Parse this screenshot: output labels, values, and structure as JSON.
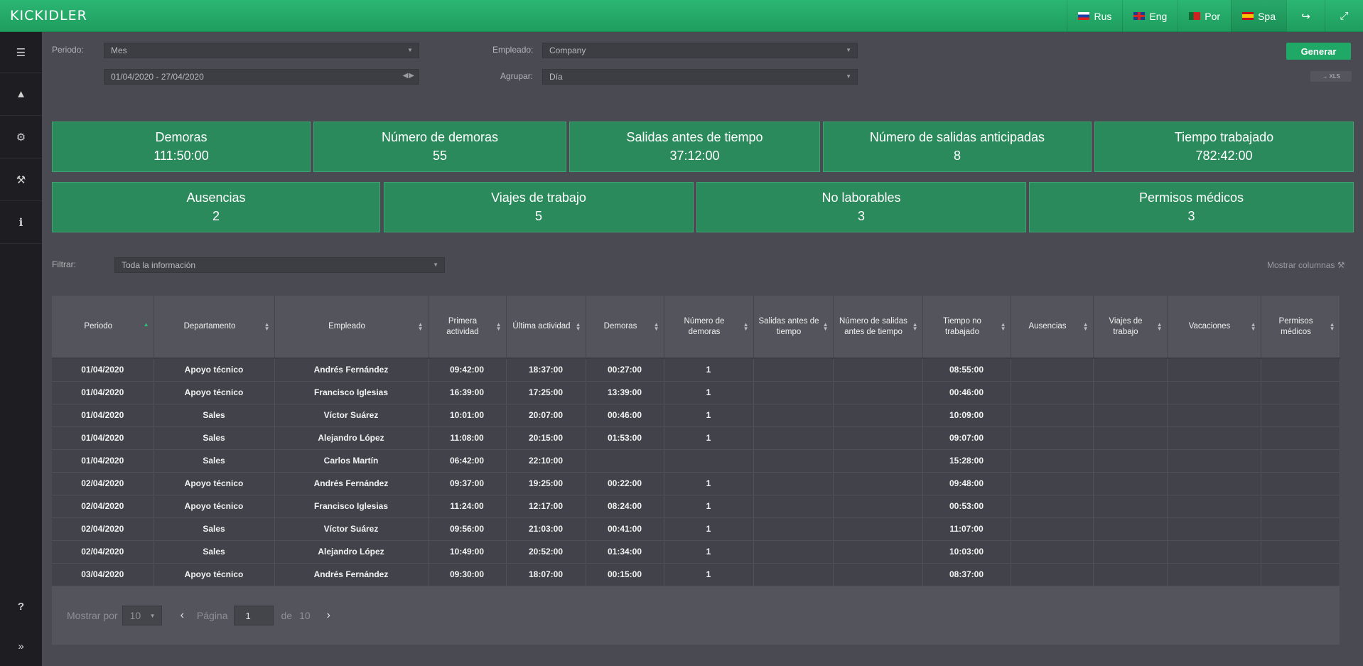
{
  "app": {
    "logo": "KICKIDLER"
  },
  "header": {
    "languages": [
      {
        "label": "Rus",
        "flag": "flag-rus"
      },
      {
        "label": "Eng",
        "flag": "flag-eng"
      },
      {
        "label": "Por",
        "flag": "flag-por"
      },
      {
        "label": "Spa",
        "flag": "flag-spa"
      }
    ],
    "active_language": "Spa"
  },
  "sidebar": {
    "items": [
      "list-icon",
      "user-icon",
      "gears-icon",
      "wrench-icon",
      "info-icon"
    ],
    "bottom": [
      "help-icon",
      "expand-icon"
    ]
  },
  "filters": {
    "period_label": "Periodo:",
    "period_value": "Mes",
    "date_range": "01/04/2020 - 27/04/2020",
    "employee_label": "Empleado:",
    "employee_value": "Company",
    "group_label": "Agrupar:",
    "group_value": "Día",
    "generate_button": "Generar",
    "xls_button": "→ XLS"
  },
  "cards_row1": [
    {
      "title": "Demoras",
      "value": "111:50:00"
    },
    {
      "title": "Número de demoras",
      "value": "55"
    },
    {
      "title": "Salidas antes de tiempo",
      "value": "37:12:00"
    },
    {
      "title": "Número de salidas anticipadas",
      "value": "8"
    },
    {
      "title": "Tiempo trabajado",
      "value": "782:42:00"
    }
  ],
  "cards_row2": [
    {
      "title": "Ausencias",
      "value": "2"
    },
    {
      "title": "Viajes de trabajo",
      "value": "5"
    },
    {
      "title": "No laborables",
      "value": "3"
    },
    {
      "title": "Permisos médicos",
      "value": "3"
    }
  ],
  "table_filter": {
    "label": "Filtrar:",
    "value": "Toda la información",
    "show_columns": "Mostrar columnas"
  },
  "table": {
    "columns": [
      "Periodo",
      "Departamento",
      "Empleado",
      "Primera actividad",
      "Última actividad",
      "Demoras",
      "Número de demoras",
      "Salidas antes de tiempo",
      "Número de salidas antes de tiempo",
      "Tiempo no trabajado",
      "Ausencias",
      "Viajes de trabajo",
      "Vacaciones",
      "Permisos médicos"
    ],
    "rows": [
      [
        "01/04/2020",
        "Apoyo técnico",
        "Andrés Fernández",
        "09:42:00",
        "18:37:00",
        "00:27:00",
        "1",
        "",
        "",
        "08:55:00",
        "",
        "",
        "",
        ""
      ],
      [
        "01/04/2020",
        "Apoyo técnico",
        "Francisco Iglesias",
        "16:39:00",
        "17:25:00",
        "13:39:00",
        "1",
        "",
        "",
        "00:46:00",
        "",
        "",
        "",
        ""
      ],
      [
        "01/04/2020",
        "Sales",
        "Víctor Suárez",
        "10:01:00",
        "20:07:00",
        "00:46:00",
        "1",
        "",
        "",
        "10:09:00",
        "",
        "",
        "",
        ""
      ],
      [
        "01/04/2020",
        "Sales",
        "Alejandro López",
        "11:08:00",
        "20:15:00",
        "01:53:00",
        "1",
        "",
        "",
        "09:07:00",
        "",
        "",
        "",
        ""
      ],
      [
        "01/04/2020",
        "Sales",
        "Carlos Martín",
        "06:42:00",
        "22:10:00",
        "",
        "",
        "",
        "",
        "15:28:00",
        "",
        "",
        "",
        ""
      ],
      [
        "02/04/2020",
        "Apoyo técnico",
        "Andrés Fernández",
        "09:37:00",
        "19:25:00",
        "00:22:00",
        "1",
        "",
        "",
        "09:48:00",
        "",
        "",
        "",
        ""
      ],
      [
        "02/04/2020",
        "Apoyo técnico",
        "Francisco Iglesias",
        "11:24:00",
        "12:17:00",
        "08:24:00",
        "1",
        "",
        "",
        "00:53:00",
        "",
        "",
        "",
        ""
      ],
      [
        "02/04/2020",
        "Sales",
        "Víctor Suárez",
        "09:56:00",
        "21:03:00",
        "00:41:00",
        "1",
        "",
        "",
        "11:07:00",
        "",
        "",
        "",
        ""
      ],
      [
        "02/04/2020",
        "Sales",
        "Alejandro López",
        "10:49:00",
        "20:52:00",
        "01:34:00",
        "1",
        "",
        "",
        "10:03:00",
        "",
        "",
        "",
        ""
      ],
      [
        "03/04/2020",
        "Apoyo técnico",
        "Andrés Fernández",
        "09:30:00",
        "18:07:00",
        "00:15:00",
        "1",
        "",
        "",
        "08:37:00",
        "",
        "",
        "",
        ""
      ]
    ]
  },
  "pager": {
    "show_per": "Mostrar por",
    "per_page": "10",
    "page_label": "Página",
    "page": "1",
    "of_label": "de",
    "total_pages": "10",
    "prev": "‹",
    "next": "›"
  }
}
